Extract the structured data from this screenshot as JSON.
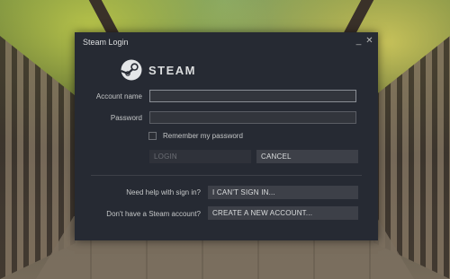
{
  "window": {
    "title": "Steam Login",
    "minimize_glyph": "_",
    "close_glyph": "✕"
  },
  "brand": {
    "logo_text": "STEAM",
    "icon": "steam-logo-icon"
  },
  "form": {
    "account_label": "Account name",
    "account_value": "",
    "password_label": "Password",
    "password_value": "",
    "remember_label": "Remember my password",
    "remember_checked": false
  },
  "buttons": {
    "login": "LOGIN",
    "cancel": "CANCEL"
  },
  "help": {
    "signin_question": "Need help with sign in?",
    "signin_button": "I CAN'T SIGN IN...",
    "account_question": "Don't have a Steam account?",
    "account_button": "CREATE A NEW ACCOUNT..."
  },
  "colors": {
    "dialog_bg": "#262a33",
    "button_bg": "#3d4048",
    "disabled_text": "#6b6e74"
  }
}
